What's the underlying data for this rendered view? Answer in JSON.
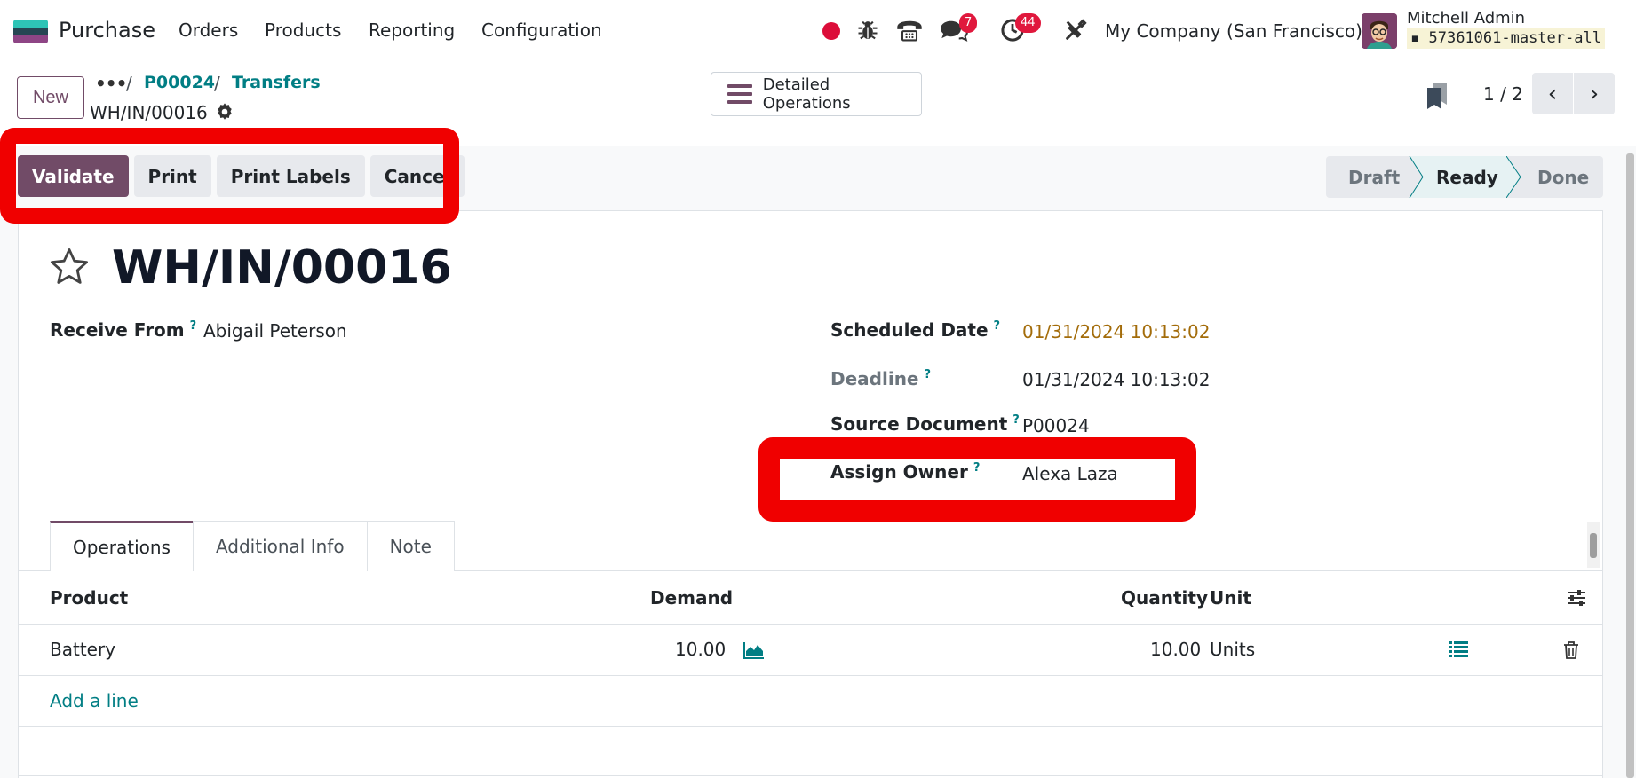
{
  "navbar": {
    "app_name": "Purchase",
    "menu": [
      "Orders",
      "Products",
      "Reporting",
      "Configuration"
    ],
    "messages_badge": "7",
    "activities_badge": "44",
    "company": "My Company (San Francisco)",
    "user_name": "Mitchell Admin",
    "database": "57361061-master-all"
  },
  "control_panel": {
    "new_label": "New",
    "breadcrumb": [
      "P00024",
      "Transfers"
    ],
    "current_record": "WH/IN/00016",
    "detailed_operations_label": "Detailed Operations",
    "pager": "1 / 2"
  },
  "actions": {
    "validate": "Validate",
    "print": "Print",
    "print_labels": "Print Labels",
    "cancel": "Cancel"
  },
  "stages": {
    "draft": "Draft",
    "ready": "Ready",
    "done": "Done",
    "current": "Ready"
  },
  "form": {
    "title": "WH/IN/00016",
    "receive_from_label": "Receive From",
    "receive_from": "Abigail Peterson",
    "scheduled_date_label": "Scheduled Date",
    "scheduled_date": "01/31/2024 10:13:02",
    "deadline_label": "Deadline",
    "deadline": "01/31/2024 10:13:02",
    "source_document_label": "Source Document",
    "source_document": "P00024",
    "assign_owner_label": "Assign Owner",
    "assign_owner": "Alexa Laza",
    "help_mark": "?"
  },
  "tabs": [
    "Operations",
    "Additional Info",
    "Note"
  ],
  "operations_table": {
    "headers": {
      "product": "Product",
      "demand": "Demand",
      "quantity": "Quantity",
      "unit": "Unit"
    },
    "rows": [
      {
        "product": "Battery",
        "demand": "10.00",
        "quantity": "10.00",
        "unit": "Units"
      }
    ],
    "add_line": "Add a line"
  },
  "colors": {
    "brand": "#714b67",
    "link": "#017e84",
    "highlight": "#f00000",
    "warning_date": "#a36c0a"
  }
}
